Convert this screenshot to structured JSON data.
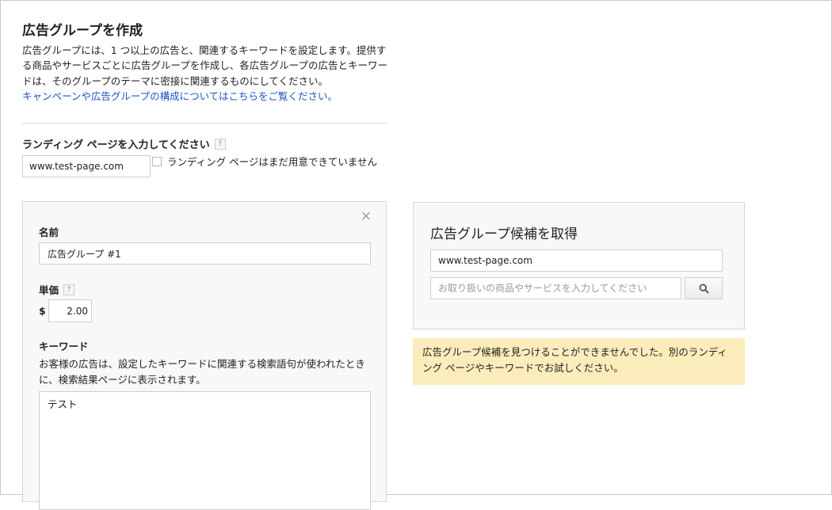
{
  "page": {
    "title": "広告グループを作成",
    "intro_text": "広告グループには、1 つ以上の広告と、関連するキーワードを設定します。提供する商品やサービスごとに広告グループを作成し、各広告グループの広告とキーワードは、そのグループのテーマに密接に関連するものにしてください。",
    "intro_link": "キャンペーンや広告グループの構成についてはこちらをご覧ください。"
  },
  "landing_page": {
    "label": "ランディング ページを入力してください",
    "help_icon": "?",
    "value": "www.test-page.com",
    "checkbox_label": "ランディング ページはまだ用意できていません",
    "checkbox_checked": false
  },
  "ad_group": {
    "close_icon": "×",
    "name_label": "名前",
    "name_value": "広告グループ #1",
    "bid_label": "単価",
    "bid_help_icon": "?",
    "currency": "$",
    "bid_value": "2.00",
    "keywords_label": "キーワード",
    "keywords_description": "お客様の広告は、設定したキーワードに関連する検索語句が使われたときに、検索結果ページに表示されます。",
    "keywords_value": "テスト"
  },
  "suggestions": {
    "title": "広告グループ候補を取得",
    "url_value": "www.test-page.com",
    "search_placeholder": "お取り扱いの商品やサービスを入力してください",
    "search_icon": "search-icon",
    "notice_text": "広告グループ候補を見つけることができませんでした。別のランディング ページやキーワードでお試しください。"
  },
  "colors": {
    "link": "#1a55c6",
    "notice_background": "#fbedbb",
    "panel_background": "#f8f8f8",
    "border": "#d6d6d6"
  }
}
